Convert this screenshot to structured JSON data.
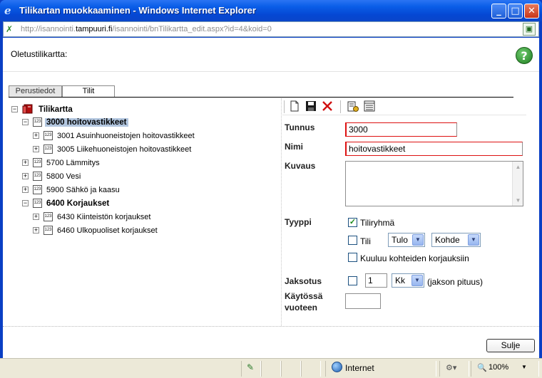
{
  "window": {
    "title": "Tilikartan muokkaaminen - Windows Internet Explorer",
    "url_prefix": "http://isannointi.",
    "url_domain": "tampuuri.fi",
    "url_suffix": "/isannointi/bnTilikartta_edit.aspx?id=4&koid=0",
    "minimize": "_",
    "maximize": "□",
    "close": "✕"
  },
  "header": {
    "title": "Oletustilikartta:",
    "help": "?"
  },
  "tabs": [
    {
      "label": "Perustiedot",
      "active": false
    },
    {
      "label": "Tilit",
      "active": true
    }
  ],
  "tree": {
    "root": {
      "expander": "−",
      "label": "Tilikartta"
    },
    "nodes": [
      {
        "expander": "−",
        "icon": "123",
        "label": "3000 hoitovastikkeet",
        "bold": true,
        "selected": true
      },
      {
        "expander": "+",
        "icon": "123",
        "label": "3001 Asuinhuoneistojen hoitovastikkeet",
        "bold": false
      },
      {
        "expander": "+",
        "icon": "123",
        "label": "3005 Liikehuoneistojen hoitovastikkeet",
        "bold": false
      },
      {
        "expander": "+",
        "icon": "123",
        "label": "5700 Lämmitys",
        "bold": false
      },
      {
        "expander": "+",
        "icon": "123",
        "label": "5800 Vesi",
        "bold": false
      },
      {
        "expander": "+",
        "icon": "123",
        "label": "5900 Sähkö ja kaasu",
        "bold": false
      },
      {
        "expander": "−",
        "icon": "123",
        "label": "6400 Korjaukset",
        "bold": true
      },
      {
        "expander": "+",
        "icon": "123",
        "label": "6430 Kiinteistön korjaukset",
        "bold": false
      },
      {
        "expander": "+",
        "icon": "123",
        "label": "6460 Ulkopuoliset korjaukset",
        "bold": false
      }
    ]
  },
  "toolbar": {
    "new": "new-document-icon",
    "save": "save-icon",
    "delete": "delete-icon",
    "props": "properties-icon",
    "list": "list-icon"
  },
  "form": {
    "tunnus_label": "Tunnus",
    "tunnus_value": "3000",
    "nimi_label": "Nimi",
    "nimi_value": "hoitovastikkeet",
    "kuvaus_label": "Kuvaus",
    "kuvaus_value": "",
    "tyyppi_label": "Tyyppi",
    "tiliryhma_label": "Tiliryhmä",
    "tiliryhma_checked": true,
    "tili_label": "Tili",
    "tili_checked": false,
    "tulo_value": "Tulo",
    "kohde_value": "Kohde",
    "kuuluu_label": "Kuuluu kohteiden korjauksiin",
    "kuuluu_checked": false,
    "jaksotus_label": "Jaksotus",
    "jaksotus_checked": false,
    "jakso_value": "1",
    "jakso_unit": "Kk",
    "jakso_hint": "(jakson pituus)",
    "kaytossa_label_1": "Käytössä",
    "kaytossa_label_2": "vuoteen",
    "kaytossa_value": ""
  },
  "footer": {
    "close_label": "Sulje"
  },
  "statusbar": {
    "zone": "Internet",
    "zoom": "100%"
  }
}
